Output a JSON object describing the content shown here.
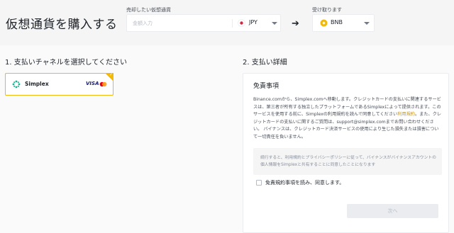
{
  "header": {
    "title": "仮想通貨を購入する",
    "sell_label": "売却したい仮想通貨",
    "amount_placeholder": "金額入力",
    "fiat_currency": "JPY",
    "receive_label": "受け取ります",
    "crypto_currency": "BNB"
  },
  "channels": {
    "section_title": "1. 支払いチャネルを選択してください",
    "items": [
      {
        "name": "Simplex",
        "card_brand": "VISA"
      }
    ]
  },
  "details": {
    "section_title": "2. 支払い詳細",
    "disclaimer_title": "免責事項",
    "disclaimer_body_1": "Binance.comから、Simplex.comへ移動します。クレジットカードの支払いに関連するサービスは、第三者が所有する独立したプラットフォームであるSimplexによって提供されます。このサービスを使用する前に、Simplexの利用規約を読んで同意してください",
    "disclaimer_link": "利用規約",
    "disclaimer_body_2": "。また、クレジットカードの支払いに関するご質問は、support@simplex.comまでお問い合わせください。 バイナンスは、クレジットカード決済サービスの使用により生じた損失または損害について一切責任を負いません。",
    "consent_note": "続行すると、利用規約とプライバシーポリシーに従って、バイナンスがバイナンスアカウントの個人情報をSimplexと共有することに同意したことになります",
    "checkbox_label": "免責規約事項を読み、同意します。",
    "next_label": "次へ"
  },
  "colors": {
    "accent": "#f0b90b",
    "visa": "#1a1f71",
    "simplex": "#1ab394"
  }
}
